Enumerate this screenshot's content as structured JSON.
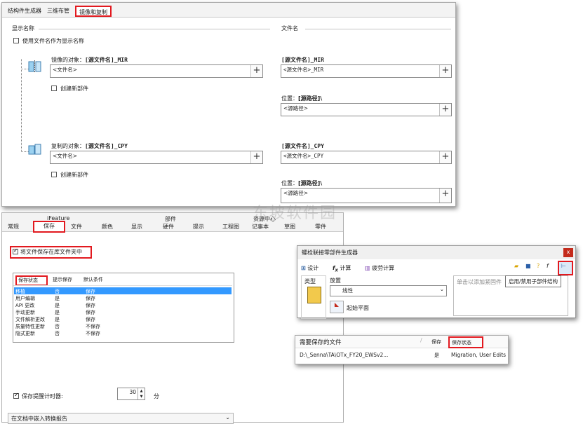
{
  "top_panel": {
    "tabs": [
      {
        "label": "结构件生成器"
      },
      {
        "label": "三维布管"
      },
      {
        "label": "镜像和复制"
      }
    ],
    "display_name_label": "显示名称",
    "file_name_label": "文件名",
    "use_filename_checkbox": "使用文件名作为显示名称",
    "mirror_object_label": "镜像的对象：",
    "mirror_object_value": "[源文件名]_MIR",
    "mirror_field_placeholder": "<文件名>",
    "create_new_part_1": "创建新部件",
    "right_mirror_title": "[源文件名]_MIR",
    "right_mirror_field": "<源文件名>_MIR",
    "location_label_1": "位置：",
    "location_value_1": "[源路径]\\",
    "location_field_1": "<源路径>",
    "copy_object_label": "复制的对象：",
    "copy_object_value": "[源文件名]_CPY",
    "copy_field_placeholder": "<文件名>",
    "create_new_part_2": "创建新部件",
    "right_copy_title": "[源文件名]_CPY",
    "right_copy_field": "<源文件名>_CPY",
    "location_label_2": "位置：",
    "location_value_2": "[源路径]\\",
    "location_field_2": "<源路径>",
    "plus_symbol": "+"
  },
  "left_panel": {
    "top_headers": [
      "iFeature",
      "部件",
      "资源中心"
    ],
    "tabs": [
      "常规",
      "保存",
      "文件",
      "颜色",
      "显示",
      "硬件",
      "提示",
      "工程图",
      "记事本",
      "草图",
      "零件"
    ],
    "save_checkbox": "将文件保存在库文件夹中",
    "columns": [
      "保存状态",
      "提示保存",
      "默认条件"
    ],
    "rows": [
      {
        "state": "移植",
        "prompt": "否",
        "default": "保存"
      },
      {
        "state": "用户编辑",
        "prompt": "是",
        "default": "保存"
      },
      {
        "state": "API 更改",
        "prompt": "是",
        "default": "保存"
      },
      {
        "state": "手动更新",
        "prompt": "是",
        "default": "保存"
      },
      {
        "state": "文件解析更改",
        "prompt": "是",
        "default": "保存"
      },
      {
        "state": "质量特性更新",
        "prompt": "否",
        "default": "不保存"
      },
      {
        "state": "隐式更新",
        "prompt": "否",
        "default": "不保存"
      }
    ],
    "reminder_checkbox": "保存提醒计时器:",
    "reminder_value": "30",
    "reminder_unit": "分",
    "dropdown_value": "在文档中嵌入转换报告"
  },
  "right_dialog": {
    "title": "螺栓联接零部件生成器",
    "close": "x",
    "tabs": [
      {
        "icon": "design-icon",
        "label": "设计"
      },
      {
        "icon": "fx-icon",
        "label": "计算"
      },
      {
        "icon": "chart-icon",
        "label": "疲劳计算"
      }
    ],
    "type_label": "类型",
    "placement_label": "放置",
    "placement_value": "线性",
    "start_plane": "起始平面",
    "add_fastener_hint": "单击以添加紧固件",
    "tooltip": "启用/禁用子部件结构"
  },
  "save_panel": {
    "header_files": "需要保存的文件",
    "header_save": "保存",
    "header_state": "保存状态",
    "row_path": "D:\\_Senna\\TA\\OTx_FY20_EWSv2...",
    "row_save": "是",
    "row_state": "Migration, User Edits"
  },
  "watermark": "东坡软件园",
  "colors": {
    "highlight_red": "#e2191f",
    "selection_blue": "#3399ff",
    "dialog_title_bg": "#f0f0f0",
    "close_red": "#c42b1c"
  }
}
